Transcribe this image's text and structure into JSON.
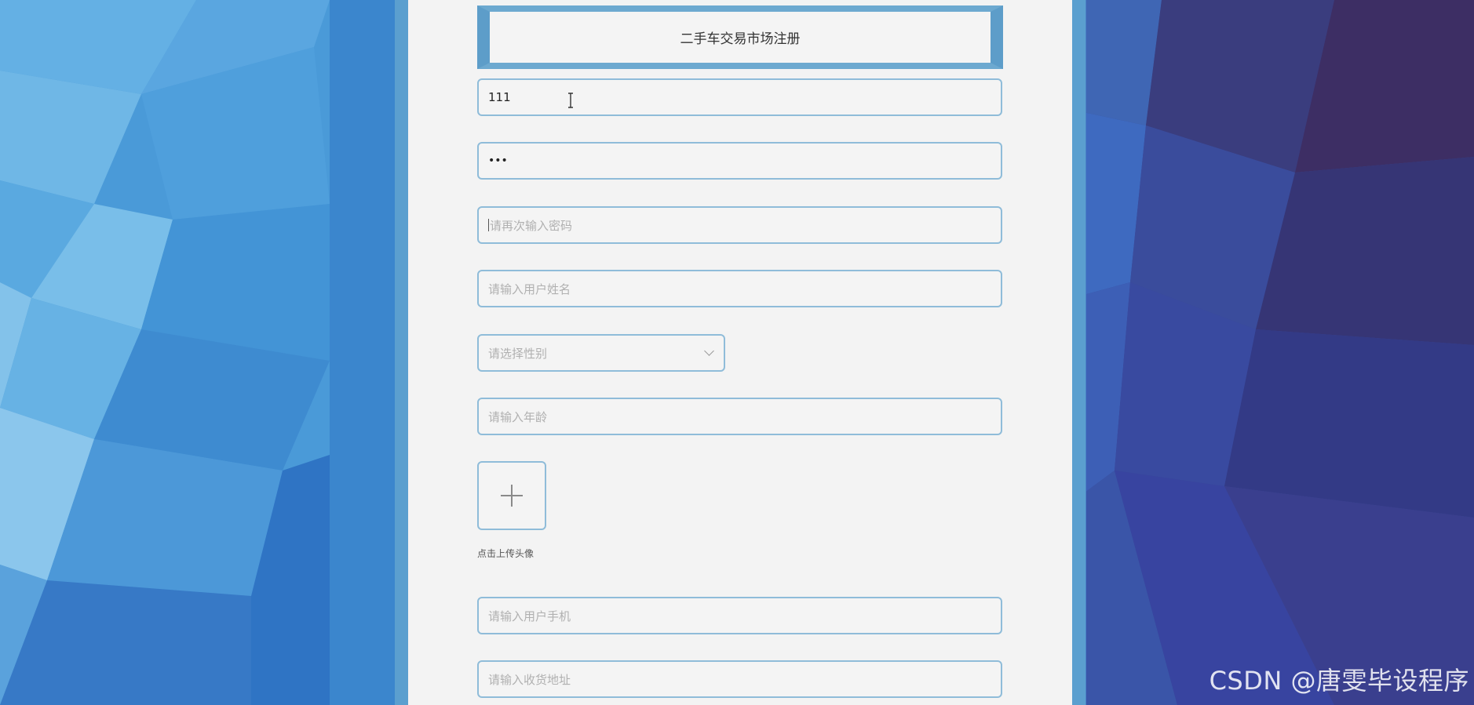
{
  "form": {
    "title": "二手车交易市场注册",
    "username_value": "111",
    "password_value": "•••",
    "confirm_password_placeholder": "请再次输入密码",
    "name_placeholder": "请输入用户姓名",
    "gender_placeholder": "请选择性别",
    "age_placeholder": "请输入年龄",
    "upload_label": "点击上传头像",
    "phone_placeholder": "请输入用户手机",
    "address_placeholder": "请输入收货地址"
  },
  "icons": {
    "upload": "plus-icon",
    "gender_dropdown": "chevron-down-icon",
    "cursor": "text-cursor-icon"
  },
  "watermark": "CSDN @唐雯毕设程序",
  "colors": {
    "panel_frame": "#5b9fcf",
    "field_border": "#8fbcd9",
    "panel_bg": "#f3f3f3"
  }
}
